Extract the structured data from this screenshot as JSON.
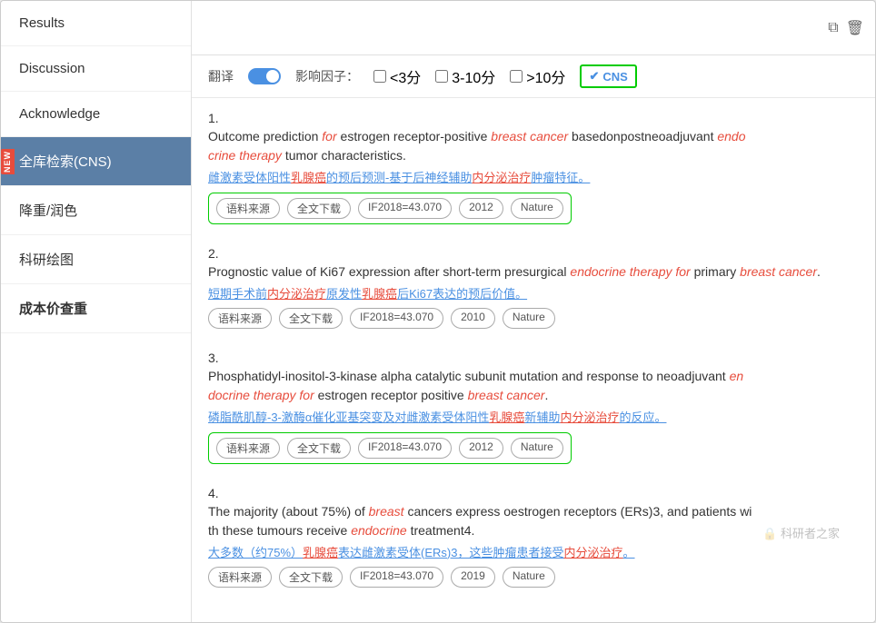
{
  "sidebar": {
    "items": [
      {
        "id": "results",
        "label": "Results",
        "active": false,
        "new": false
      },
      {
        "id": "discussion",
        "label": "Discussion",
        "active": false,
        "new": false
      },
      {
        "id": "acknowledge",
        "label": "Acknowledge",
        "active": false,
        "new": false
      },
      {
        "id": "quanku",
        "label": "全库检索(CNS)",
        "active": true,
        "new": true
      },
      {
        "id": "jiangchong",
        "label": "降重/润色",
        "active": false,
        "new": false
      },
      {
        "id": "keyan",
        "label": "科研绘图",
        "active": false,
        "new": false
      },
      {
        "id": "chengben",
        "label": "成本价查重",
        "active": false,
        "new": false
      }
    ]
  },
  "filter": {
    "translate_label": "翻译",
    "impact_label": "影响因子：",
    "lt3_label": "<3分",
    "range_label": "3-10分",
    "gt10_label": ">10分",
    "cns_label": "CNS"
  },
  "results": [
    {
      "id": 1,
      "title_parts": [
        {
          "text": "Outcome prediction ",
          "style": "normal"
        },
        {
          "text": "for",
          "style": "italic-red"
        },
        {
          "text": " estrogen receptor-positive ",
          "style": "normal"
        },
        {
          "text": "breast cancer",
          "style": "italic-red"
        },
        {
          "text": " basedonpostneoadjuvant ",
          "style": "normal"
        },
        {
          "text": "endocrine therapy",
          "style": "italic-red"
        },
        {
          "text": " tumor characteristics.",
          "style": "normal"
        }
      ],
      "chinese": "雌激素受体阳性乳腺癌的预后预测-基于后辅助内分泌治疗肿瘤特征。",
      "tags": [
        "语料来源",
        "全文下载",
        "IF2018=43.070",
        "2012",
        "Nature"
      ],
      "tags_green": true
    },
    {
      "id": 2,
      "title_parts": [
        {
          "text": "Prognostic value of Ki67 expression after short-term presurgical ",
          "style": "normal"
        },
        {
          "text": "endocrine therapy for",
          "style": "italic-red"
        },
        {
          "text": " primary ",
          "style": "normal"
        },
        {
          "text": "breast cancer",
          "style": "italic-red"
        },
        {
          "text": ".",
          "style": "normal"
        }
      ],
      "chinese": "短期手术前内分泌治疗原发性乳腺癌后Ki67表达的预后价值。",
      "tags": [
        "语料来源",
        "全文下载",
        "IF2018=43.070",
        "2010",
        "Nature"
      ],
      "tags_green": false
    },
    {
      "id": 3,
      "title_parts": [
        {
          "text": "Phosphatidyl-inositol-3-kinase alpha catalytic subunit mutation and response to neoadjuvant ",
          "style": "normal"
        },
        {
          "text": "endocrine therapy for",
          "style": "italic-red"
        },
        {
          "text": " estrogen receptor positive ",
          "style": "normal"
        },
        {
          "text": "breast cancer",
          "style": "italic-red"
        },
        {
          "text": ".",
          "style": "normal"
        }
      ],
      "chinese": "磷脂酰肌醇-3-激酶α催化亚基突变及对雌激素受体阳性乳腺癌新辅助内分泌治疗的反应。",
      "tags": [
        "语料来源",
        "全文下载",
        "IF2018=43.070",
        "2012",
        "Nature"
      ],
      "tags_green": true
    },
    {
      "id": 4,
      "title_parts": [
        {
          "text": "The majority (about 75%) of ",
          "style": "normal"
        },
        {
          "text": "breast",
          "style": "italic-red"
        },
        {
          "text": " cancers express oestrogen receptors (ERs)3, and patients with these tumours receive ",
          "style": "normal"
        },
        {
          "text": "endocrine",
          "style": "italic-red"
        },
        {
          "text": " treatment4.",
          "style": "normal"
        }
      ],
      "chinese": "大多数（约75%）乳腺癌表达雌激素受体(ERs)3，这些肿瘤患者接受内分泌治疗。",
      "tags": [
        "语料来源",
        "全文下载",
        "IF2018=43.070",
        "2019",
        "Nature"
      ],
      "tags_green": false
    }
  ],
  "watermark": "科研者之家"
}
